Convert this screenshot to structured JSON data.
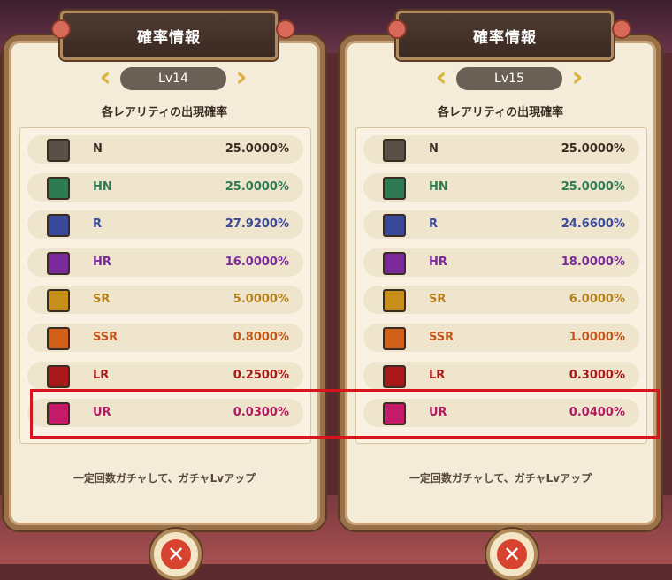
{
  "panels": [
    {
      "title": "確率情報",
      "level": "Lv14",
      "subtitle": "各レアリティの出現確率",
      "rows": [
        {
          "name": "N",
          "value": "25.0000%",
          "color": "#5a5048",
          "text": "#3a2c22"
        },
        {
          "name": "HN",
          "value": "25.0000%",
          "color": "#2e7a52",
          "text": "#2e7a52"
        },
        {
          "name": "R",
          "value": "27.9200%",
          "color": "#3a4a9a",
          "text": "#3a4a9a"
        },
        {
          "name": "HR",
          "value": "16.0000%",
          "color": "#7a2a9a",
          "text": "#7a2a9a"
        },
        {
          "name": "SR",
          "value": "5.0000%",
          "color": "#c8901a",
          "text": "#b4801a"
        },
        {
          "name": "SSR",
          "value": "0.8000%",
          "color": "#d0601a",
          "text": "#c0561a"
        },
        {
          "name": "LR",
          "value": "0.2500%",
          "color": "#a81a1a",
          "text": "#a81a1a"
        },
        {
          "name": "UR",
          "value": "0.0300%",
          "color": "#c41a6a",
          "text": "#b01a60"
        }
      ],
      "footer": "一定回数ガチャして、ガチャLvアップ"
    },
    {
      "title": "確率情報",
      "level": "Lv15",
      "subtitle": "各レアリティの出現確率",
      "rows": [
        {
          "name": "N",
          "value": "25.0000%",
          "color": "#5a5048",
          "text": "#3a2c22"
        },
        {
          "name": "HN",
          "value": "25.0000%",
          "color": "#2e7a52",
          "text": "#2e7a52"
        },
        {
          "name": "R",
          "value": "24.6600%",
          "color": "#3a4a9a",
          "text": "#3a4a9a"
        },
        {
          "name": "HR",
          "value": "18.0000%",
          "color": "#7a2a9a",
          "text": "#7a2a9a"
        },
        {
          "name": "SR",
          "value": "6.0000%",
          "color": "#c8901a",
          "text": "#b4801a"
        },
        {
          "name": "SSR",
          "value": "1.0000%",
          "color": "#d0601a",
          "text": "#c0561a"
        },
        {
          "name": "LR",
          "value": "0.3000%",
          "color": "#a81a1a",
          "text": "#a81a1a"
        },
        {
          "name": "UR",
          "value": "0.0400%",
          "color": "#c41a6a",
          "text": "#b01a60"
        }
      ],
      "footer": "一定回数ガチャして、ガチャLvアップ"
    }
  ],
  "arrows": {
    "prev": "‹",
    "next": "›"
  },
  "close_symbol": "✕",
  "highlight_color": "#d8141c"
}
